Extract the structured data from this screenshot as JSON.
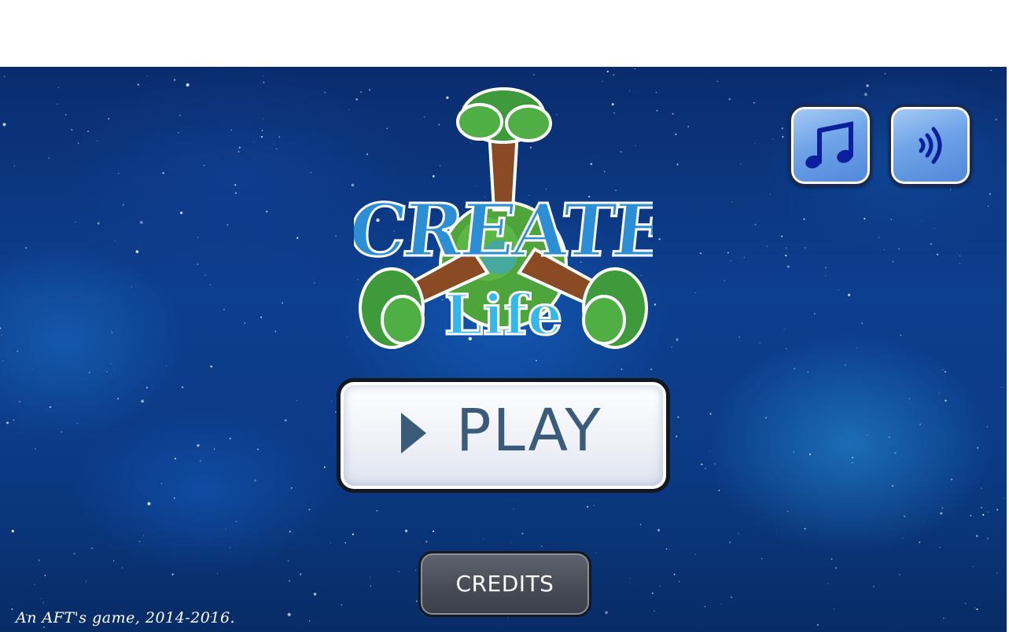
{
  "game": {
    "logo": {
      "title_line1": "CREATE",
      "title_line2": "Life"
    },
    "buttons": {
      "play_label": "PLAY",
      "credits_label": "CREDITS",
      "music_icon": "music-note-icon",
      "sound_icon": "sound-waves-icon"
    },
    "footer": {
      "copyright": "An AFT's game, 2014-2016."
    }
  },
  "colors": {
    "sky_dark": "#0a2c6e",
    "logo_blue": "#2c8fd6",
    "tree_green": "#3e9a3a",
    "trunk_brown": "#8a4a24",
    "play_text": "#3a5c7a",
    "credits_bg": "#474c56",
    "icon_button_bg": "#6fa3e8"
  }
}
